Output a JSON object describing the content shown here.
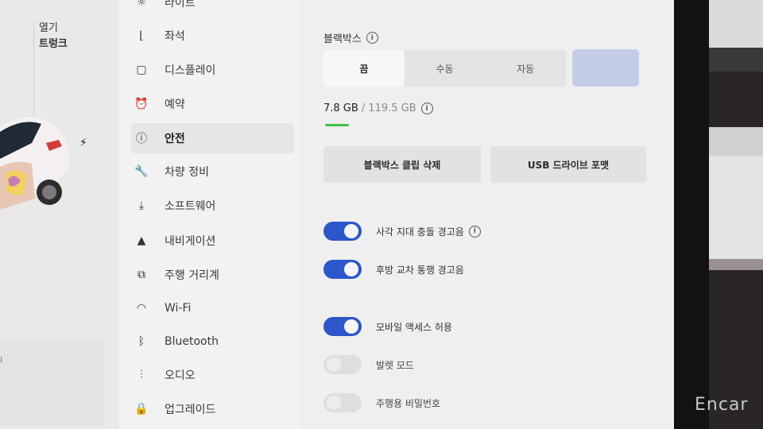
{
  "quick_menu": [
    "열기",
    "트렁크"
  ],
  "menu": {
    "items": [
      {
        "label": "라이트",
        "icon": "sun-icon"
      },
      {
        "label": "좌석",
        "icon": "seat-icon"
      },
      {
        "label": "디스플레이",
        "icon": "display-icon"
      },
      {
        "label": "예약",
        "icon": "alarm-clock-icon"
      },
      {
        "label": "안전",
        "icon": "alert-circle-icon"
      },
      {
        "label": "차량 정비",
        "icon": "wrench-icon"
      },
      {
        "label": "소프트웨어",
        "icon": "download-icon"
      },
      {
        "label": "내비게이션",
        "icon": "navigation-arrow-icon"
      },
      {
        "label": "주행 거리계",
        "icon": "odometer-icon"
      },
      {
        "label": "Wi-Fi",
        "icon": "wifi-icon"
      },
      {
        "label": "Bluetooth",
        "icon": "bluetooth-icon"
      },
      {
        "label": "오디오",
        "icon": "equalizer-icon"
      },
      {
        "label": "업그레이드",
        "icon": "lock-icon"
      }
    ],
    "active": "안전"
  },
  "dashcam": {
    "title": "블랙박스",
    "options": [
      "끔",
      "수동",
      "자동"
    ],
    "selected": "끔",
    "storage_used": "7.8 GB",
    "storage_total": "/ 119.5 GB",
    "storage_fraction": 0.065,
    "delete_clips_label": "블랙박스 클립 삭제",
    "format_usb_label": "USB 드라이브 포맷"
  },
  "toggles": [
    {
      "label": "사각 지대 충돌 경고음",
      "on": true,
      "info": true
    },
    {
      "label": "후방 교차 통행 경고음",
      "on": true,
      "info": false
    },
    {
      "label": "모바일 액세스 허용",
      "on": true,
      "info": false
    },
    {
      "label": "발렛 모드",
      "on": false,
      "info": false
    },
    {
      "label": "주행용 비밀번호",
      "on": false,
      "info": false
    }
  ],
  "colors": {
    "toggle_on": "#2c56c9",
    "accent_green": "#3cc04a"
  },
  "watermark": "Encar"
}
